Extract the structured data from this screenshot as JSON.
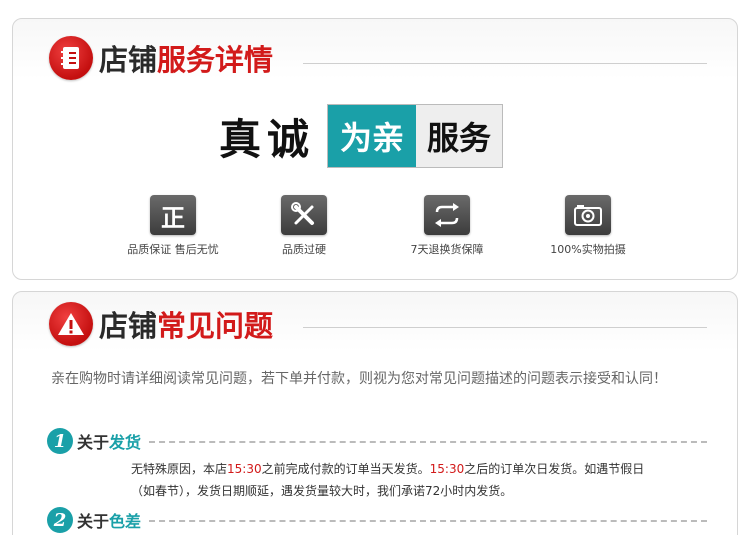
{
  "section1": {
    "title_black": "店铺",
    "title_red": "服务详情",
    "icon": "notebook-icon",
    "banner": {
      "black": "真诚",
      "teal": "为亲",
      "grey": "服务"
    },
    "features": [
      {
        "icon": "zheng-badge-icon",
        "glyph": "正",
        "label": "品质保证 售后无忧"
      },
      {
        "icon": "tools-icon",
        "label": "品质过硬"
      },
      {
        "icon": "exchange-arrows-icon",
        "label": "7天退换货保障"
      },
      {
        "icon": "camera-icon",
        "label": "100%实物拍摄"
      }
    ]
  },
  "section2": {
    "title_black": "店铺",
    "title_red": "常见问题",
    "icon": "warning-icon",
    "notice": "亲在购物时请详细阅读常见问题，若下单并付款，则视为您对常见问题描述的问题表示接受和认同！",
    "faqs": [
      {
        "num": "1",
        "prefix": "关于",
        "topic": "发货",
        "body": {
          "t1": "无特殊原因，本店",
          "h1": "15:30",
          "t2": "之前完成付款的订单当天发货。",
          "h2": "15:30",
          "t3": "之后的订单次日发货。如遇节假日（如春节），发货日期顺延，遇发货量较大时，我们承诺72小时内发货。"
        }
      },
      {
        "num": "2",
        "prefix": "关于",
        "topic": "色差"
      }
    ]
  },
  "colors": {
    "red": "#d21a1a",
    "teal": "#1aa0a8",
    "icon_grey": "#4a4a4a"
  }
}
